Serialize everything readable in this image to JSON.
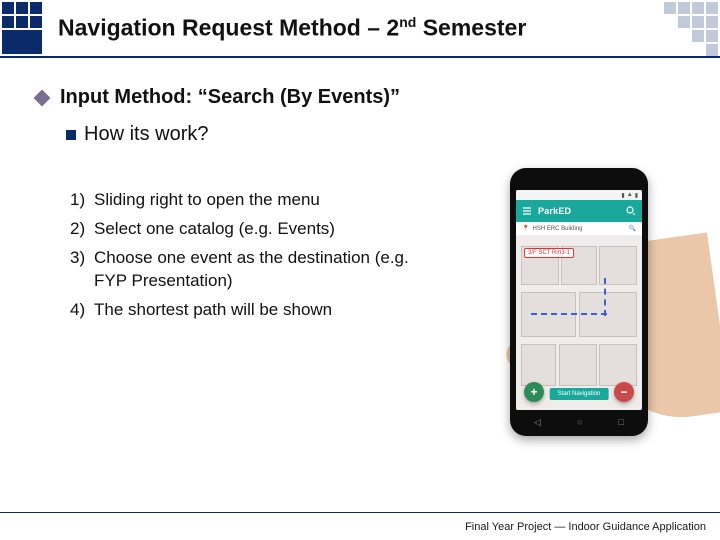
{
  "header": {
    "title_prefix": "Navigation Request Method – 2",
    "title_sup": "nd",
    "title_suffix": " Semester"
  },
  "body": {
    "input_method_label": "Input Method: “Search (By Events)”",
    "how_it_works_label": "How its work?",
    "steps": [
      {
        "n": "1)",
        "t": "Sliding right to open the menu"
      },
      {
        "n": "2)",
        "t": "Select one catalog (e.g. Events)"
      },
      {
        "n": "3)",
        "t": "Choose one event as the destination (e.g. FYP Presentation)"
      },
      {
        "n": "4)",
        "t": "The shortest path will be shown"
      }
    ]
  },
  "phone": {
    "app_title": "ParkED",
    "search_bar": "HSH ERC Building",
    "pin_label": "3/F SCT Rm3-1",
    "start_button": "Start Navigation",
    "fab_plus": "+",
    "fab_minus": "−",
    "nav_back": "◁",
    "nav_home": "○",
    "nav_recent": "□"
  },
  "footer": {
    "text": "Final Year Project — Indoor Guidance Application"
  }
}
